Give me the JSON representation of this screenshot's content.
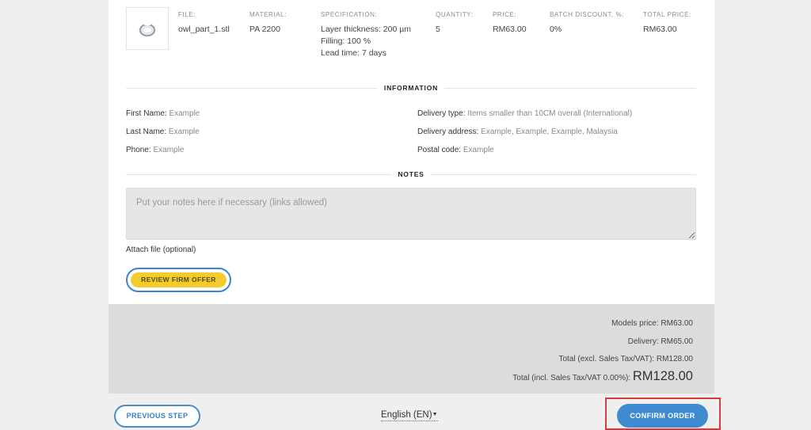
{
  "item": {
    "file_label": "FILE:",
    "file_value": "owl_part_1.stl",
    "material_label": "MATERIAL:",
    "material_value": "PA 2200",
    "spec_label": "SPECIFICATION:",
    "spec_lines": [
      "Layer thickness: 200 µm",
      "Filling: 100 %",
      "Lead time: 7 days"
    ],
    "quantity_label": "QUANTITY:",
    "quantity_value": "5",
    "price_label": "PRICE:",
    "price_value": "RM63.00",
    "discount_label": "BATCH DISCOUNT, %:",
    "discount_value": "0%",
    "total_label": "TOTAL PRICE:",
    "total_value": "RM63.00",
    "thumbnail_icon": "ring-model-thumbnail"
  },
  "information": {
    "title": "INFORMATION",
    "first_name_label": "First Name:",
    "first_name_value": "Example",
    "last_name_label": "Last Name:",
    "last_name_value": "Example",
    "phone_label": "Phone:",
    "phone_value": "Example",
    "delivery_type_label": "Delivery type:",
    "delivery_type_value": "Items smaller than 10CM overall (International)",
    "delivery_address_label": "Delivery address:",
    "delivery_address_value": "Example, Example, Example, Malaysia",
    "postal_code_label": "Postal code:",
    "postal_code_value": "Example"
  },
  "notes": {
    "title": "NOTES",
    "placeholder": "Put your notes here if necessary (links allowed)",
    "attach_label": "Attach file (optional)"
  },
  "actions": {
    "review_label": "REVIEW FIRM OFFER",
    "previous_label": "PREVIOUS STEP",
    "confirm_label": "CONFIRM ORDER",
    "language": "English (EN)"
  },
  "totals": {
    "models_price": "Models price: RM63.00",
    "delivery": "Delivery: RM65.00",
    "total_excl": "Total (excl. Sales Tax/VAT): RM128.00",
    "total_incl_label": "Total (incl. Sales Tax/VAT 0.00%):",
    "total_incl_value": "RM128.00"
  },
  "colors": {
    "accent_blue": "#3f8ad0",
    "review_yellow": "#f3cb2c",
    "highlight_red": "#d23c3c",
    "totals_bg": "#dcdcdc"
  }
}
